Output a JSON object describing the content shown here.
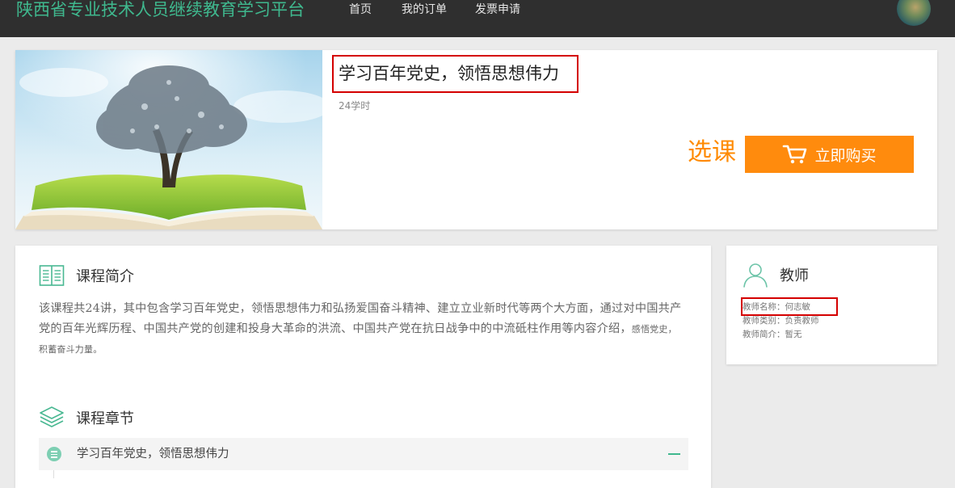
{
  "header": {
    "site_title": "陕西省专业技术人员继续教育学习平台",
    "nav": [
      "首页",
      "我的订单",
      "发票申请"
    ]
  },
  "course": {
    "title": "学习百年党史，领悟思想伟力",
    "hours": "24学时",
    "select_label": "选课",
    "buy_label": "立即购买"
  },
  "intro": {
    "heading": "课程简介",
    "text": "该课程共24讲，其中包含学习百年党史，领悟思想伟力和弘扬爱国奋斗精神、建立立业新时代等两个大方面，通过对中国共产党的百年光辉历程、中国共产党的创建和投身大革命的洪流、中国共产党在抗日战争中的中流砥柱作用等内容介绍，",
    "text_tail": "感悟党史，积蓄奋斗力量。"
  },
  "chapters": {
    "heading": "课程章节",
    "items": [
      "学习百年党史，领悟思想伟力"
    ]
  },
  "teacher": {
    "heading": "教师",
    "name_line": "教师名称：何志敏",
    "type_line": "教师类别：负责教师",
    "bio_line": "教师简介：暂无"
  },
  "colors": {
    "brand_green": "#3fb88e",
    "accent_orange": "#ff8b0d",
    "highlight_red": "#d40000"
  }
}
